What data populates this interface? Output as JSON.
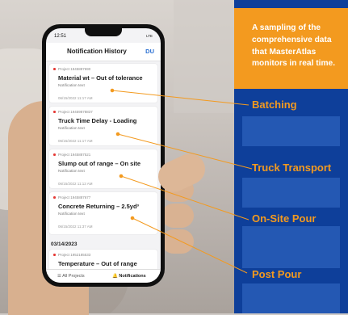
{
  "panel": {
    "message": "A sampling of the comprehensive data that MasterAtlas monitors in real time.",
    "labels": [
      "Batching",
      "Truck Transport",
      "On-Site Pour",
      "Post Pour"
    ],
    "colors": {
      "blue": "#0e3f9a",
      "orange": "#f39a1f"
    }
  },
  "phone": {
    "time": "12:51",
    "indicators": "LTE",
    "title": "Notification History",
    "user": "DU",
    "cards": [
      {
        "project": "Project 1945887690",
        "title": "Material wt – Out of tolerance",
        "text": "Notification text",
        "date": "06/15/2022 11:17 AM"
      },
      {
        "project": "Project 19459878837",
        "title": "Truck Time Delay - Loading",
        "text": "Notification text",
        "date": "06/15/2022 11:17 AM"
      },
      {
        "project": "Project 1945887521",
        "title": "Slump out of range – On site",
        "text": "Notification text",
        "date": "06/15/2022 11:12 AM"
      },
      {
        "project": "Project 1945887677",
        "title": "Concrete Returning – 2.5yd³",
        "text": "Notification text",
        "date": "06/15/2022 11:37 AM"
      }
    ],
    "date_header": "03/14/2023",
    "partial_card": {
      "project": "Project 1952185533",
      "title": "Temperature – Out of range"
    },
    "tabs": {
      "all_projects": "All Projects",
      "notifications": "Notifications"
    }
  }
}
